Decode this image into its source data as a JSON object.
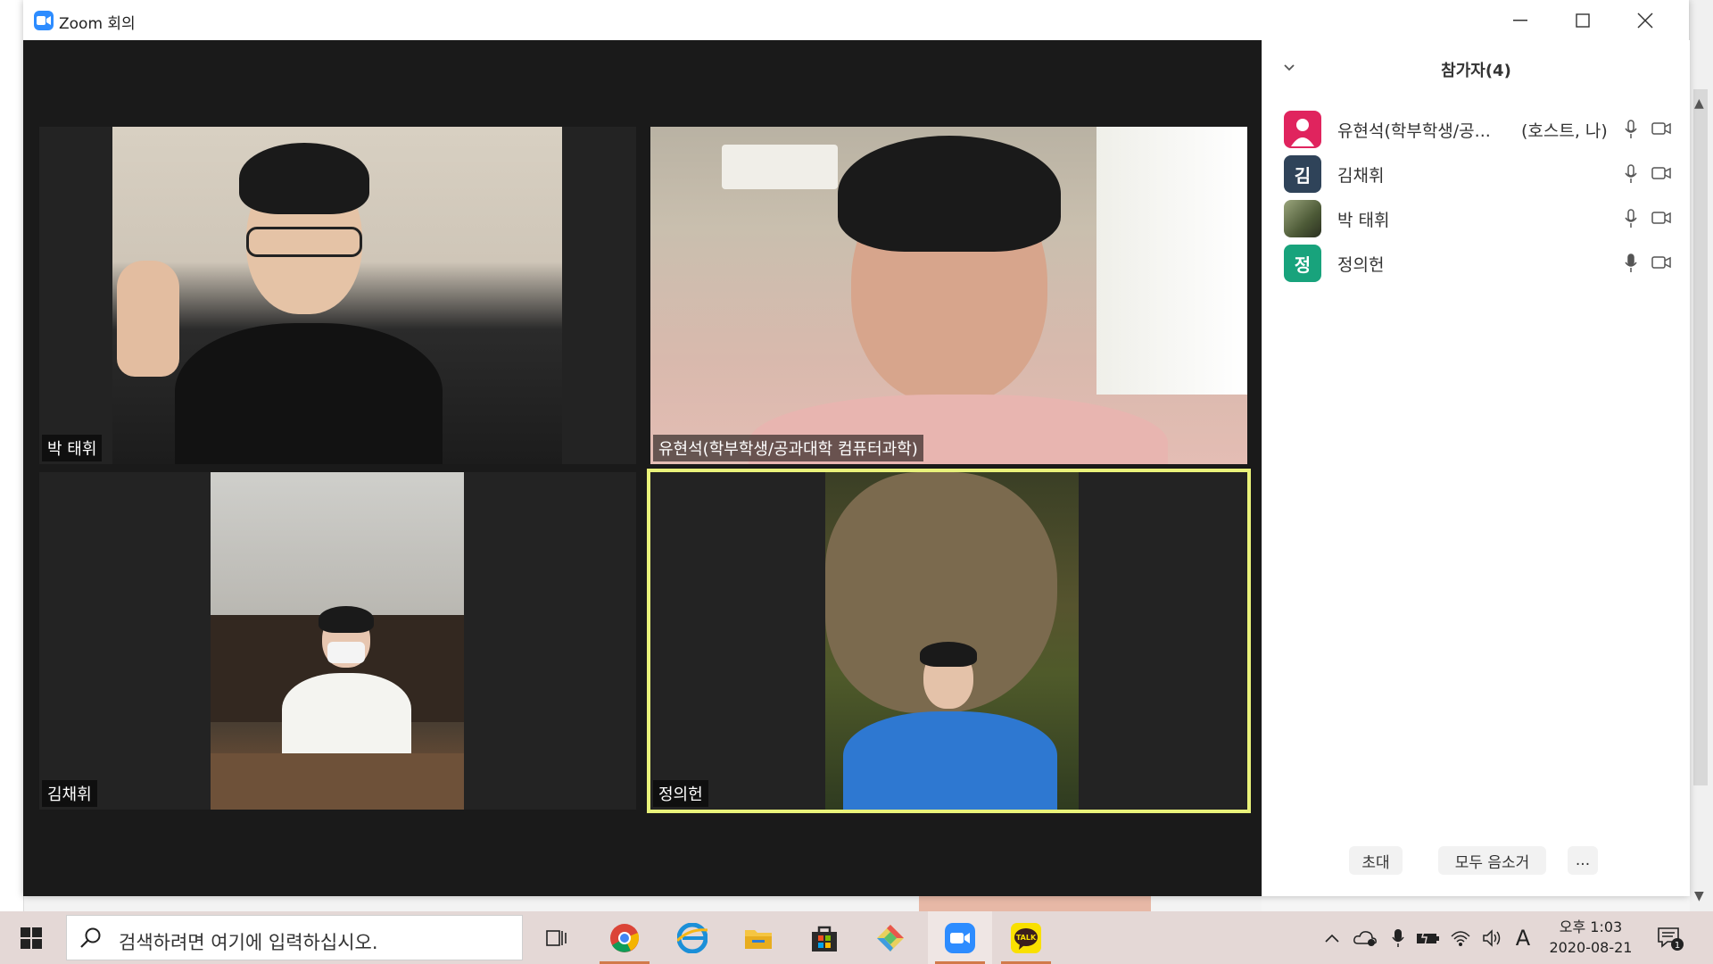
{
  "window": {
    "title": "Zoom 회의"
  },
  "colors": {
    "zoom_blue": "#2d8cff",
    "active_speaker_border": "#e9f27a",
    "taskbar": "#e4d8d6"
  },
  "video_tiles": [
    {
      "name": "박 태휘",
      "active": false
    },
    {
      "name": "유현석(학부학생/공과대학 컴퓨터과학)",
      "active": false
    },
    {
      "name": "김채휘",
      "active": false
    },
    {
      "name": "정의헌",
      "active": true
    }
  ],
  "panel": {
    "title": "참가자(4)",
    "participants": [
      {
        "name": "유현석(학부학생/공...",
        "extra": "(호스트, 나)",
        "avatar_letter": "",
        "avatar_color": "#e0245e",
        "avatar_icon": "person-icon"
      },
      {
        "name": "김채휘",
        "extra": "",
        "avatar_letter": "김",
        "avatar_color": "#2f4359",
        "avatar_icon": ""
      },
      {
        "name": "박 태휘",
        "extra": "",
        "avatar_letter": "",
        "avatar_color": "#6b7a4f",
        "avatar_icon": "photo-avatar"
      },
      {
        "name": "정의헌",
        "extra": "",
        "avatar_letter": "정",
        "avatar_color": "#18a37c",
        "avatar_icon": ""
      }
    ],
    "buttons": {
      "invite": "초대",
      "mute_all": "모두 음소거",
      "more": "..."
    }
  },
  "taskbar": {
    "search_placeholder": "검색하려면 여기에 입력하십시오.",
    "apps": [
      "task-view-icon",
      "chrome-icon",
      "edge-icon",
      "file-explorer-icon",
      "store-icon",
      "git-icon",
      "zoom-icon",
      "kakaotalk-icon"
    ],
    "kakao_label": "TALK",
    "ime": "A",
    "clock_time": "오후 1:03",
    "clock_date": "2020-08-21",
    "notification_count": "1"
  }
}
